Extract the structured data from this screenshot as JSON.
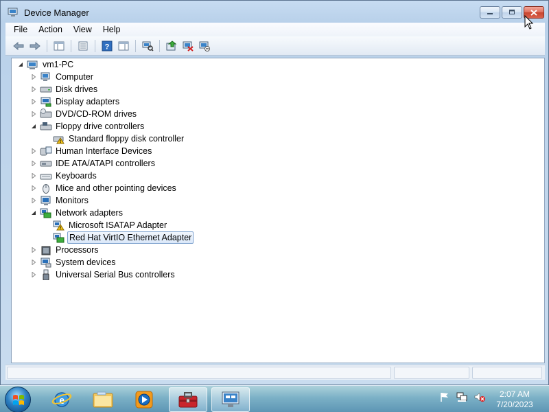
{
  "window": {
    "title": "Device Manager"
  },
  "menu": [
    "File",
    "Action",
    "View",
    "Help"
  ],
  "toolbar_icons": [
    "back-icon",
    "forward-icon",
    "show-hide-console-tree-icon",
    "properties-icon",
    "help-icon",
    "action-pane-icon",
    "scan-hardware-icon",
    "update-driver-icon",
    "uninstall-icon",
    "disable-icon"
  ],
  "tree": [
    {
      "label": "vm1-PC",
      "level": 0,
      "expander": "expanded",
      "icon": "computer-root-icon"
    },
    {
      "label": "Computer",
      "level": 1,
      "expander": "collapsed",
      "icon": "computer-icon"
    },
    {
      "label": "Disk drives",
      "level": 1,
      "expander": "collapsed",
      "icon": "disk-drive-icon"
    },
    {
      "label": "Display adapters",
      "level": 1,
      "expander": "collapsed",
      "icon": "display-adapter-icon"
    },
    {
      "label": "DVD/CD-ROM drives",
      "level": 1,
      "expander": "collapsed",
      "icon": "dvd-drive-icon"
    },
    {
      "label": "Floppy drive controllers",
      "level": 1,
      "expander": "expanded",
      "icon": "floppy-controller-icon"
    },
    {
      "label": "Standard floppy disk controller",
      "level": 2,
      "expander": "none",
      "icon": "warning-device-icon"
    },
    {
      "label": "Human Interface Devices",
      "level": 1,
      "expander": "collapsed",
      "icon": "hid-icon"
    },
    {
      "label": "IDE ATA/ATAPI controllers",
      "level": 1,
      "expander": "collapsed",
      "icon": "ide-controller-icon"
    },
    {
      "label": "Keyboards",
      "level": 1,
      "expander": "collapsed",
      "icon": "keyboard-icon"
    },
    {
      "label": "Mice and other pointing devices",
      "level": 1,
      "expander": "collapsed",
      "icon": "mouse-icon"
    },
    {
      "label": "Monitors",
      "level": 1,
      "expander": "collapsed",
      "icon": "monitor-icon"
    },
    {
      "label": "Network adapters",
      "level": 1,
      "expander": "expanded",
      "icon": "network-adapter-icon"
    },
    {
      "label": "Microsoft ISATAP Adapter",
      "level": 2,
      "expander": "none",
      "icon": "warning-network-icon"
    },
    {
      "label": "Red Hat VirtIO Ethernet Adapter",
      "level": 2,
      "expander": "none",
      "icon": "network-adapter-icon",
      "selected": true
    },
    {
      "label": "Processors",
      "level": 1,
      "expander": "collapsed",
      "icon": "processor-icon"
    },
    {
      "label": "System devices",
      "level": 1,
      "expander": "collapsed",
      "icon": "system-device-icon"
    },
    {
      "label": "Universal Serial Bus controllers",
      "level": 1,
      "expander": "collapsed",
      "icon": "usb-icon"
    }
  ],
  "taskbar": {
    "pinned": [
      "internet-explorer-icon",
      "windows-explorer-icon",
      "media-player-icon",
      "toolbox-icon",
      "device-manager-icon"
    ],
    "active_index": 4,
    "tray_icons": [
      "action-center-flag-icon",
      "network-icon",
      "volume-muted-icon"
    ],
    "time": "2:07 AM",
    "date": "7/20/2023"
  }
}
